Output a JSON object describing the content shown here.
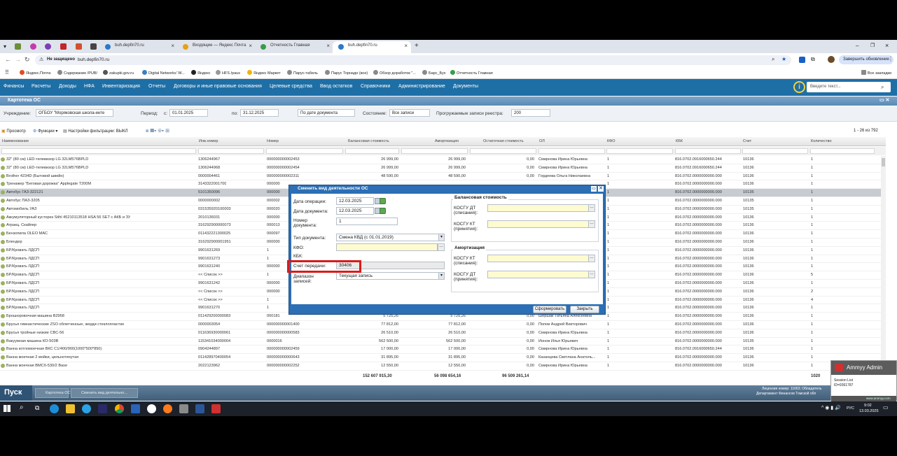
{
  "browser": {
    "tabs": [
      {
        "label": "buh.depfin70.ru"
      },
      {
        "label": "Входящие — Яндекс Почта"
      },
      {
        "label": "Отчетность Главная"
      },
      {
        "label": "buh.depfin70.ru"
      }
    ],
    "new_tab": "+",
    "security_label": "Не защищено",
    "url": "buh.depfin70.ru",
    "update_button": "Завершить обновление",
    "bookmarks": [
      "Яндекс.Почта",
      "Содержание /PUB/",
      "zakupki.gov.ru",
      "Digital Networks' W...",
      "Яндекс",
      "HFS /paus",
      "Яндекс Маркет",
      "Парус-табель",
      "Парус Торнадо (все)",
      "Обзор доработок \"...",
      "Барс_Бух",
      "Отчетность Главная"
    ],
    "all_bookmarks": "Все закладки"
  },
  "app_menu": [
    "Финансы",
    "Расчеты",
    "Доходы",
    "НФА",
    "Инвентаризация",
    "Отчеты",
    "Договоры и иные правовые основания",
    "Целевые средства",
    "Ввод остатков",
    "Справочники",
    "Администрирование",
    "Документы"
  ],
  "search_placeholder": "Введите текст...",
  "window_title": "Картотека ОС",
  "filters": {
    "institution_label": "Учреждение:",
    "institution_value": "ОГБОУ \"Моряковская школа-инте",
    "period_label": "Период:",
    "from_label": "с:",
    "from_value": "01.01.2025",
    "to_label": "по:",
    "to_value": "31.12.2025",
    "date_mode": "По дате документа",
    "state_label": "Состояние:",
    "state_value": "Все записи",
    "registry_label": "Прогружаемые записи реестра:",
    "registry_value": "200"
  },
  "toolbar": {
    "view": "Просмотр",
    "functions": "Функции",
    "filter_settings": "Настройки фильтрации: ВЫКЛ",
    "pager": "1 - 26 из 792"
  },
  "columns": [
    "Наименование",
    "Инв.номер",
    "Номер",
    "Балансовая стоимость",
    "Амортизация",
    "Остаточная стоимость",
    "ОЛ",
    "КФО",
    "КБК",
    "Счет",
    "Количество"
  ],
  "rows": [
    [
      "32\" (80 см) LED-телевизор LG 32LM576BPLD",
      "1306244967",
      "000000000002453",
      "26 999,00",
      "26 999,00",
      "0,00",
      "Смирнова Ирина Юрьевна",
      "1",
      "816.0702.0916000650.244",
      "10136",
      "1"
    ],
    [
      "32\" (80 см) LED-телевизор LG 32LM576BPLD",
      "1306244968",
      "000000000002454",
      "26 999,00",
      "26 999,00",
      "0,00",
      "Смирнова Ирина Юрьевна",
      "1",
      "816.0702.0916000650.244",
      "10136",
      "1"
    ],
    [
      "Brother 4234D (Бытовой швейн)",
      "0000004461",
      "000000000002311",
      "48 590,00",
      "48 590,00",
      "0,00",
      "Гордеева Ольга Николаевна",
      "1",
      "816.0702.0000000000.000",
      "10136",
      "1"
    ],
    [
      "Тренажер \"Беговая дорожка\" Applegate T200M",
      "3143322001700",
      "000000",
      "",
      "",
      "",
      "",
      "1",
      "816.0702.0000000000.000",
      "10136",
      "1"
    ],
    [
      "Автобус ГАЗ-322121",
      "5101350096",
      "000000",
      "",
      "",
      "",
      "",
      "1",
      "816.0702.0000000000.000",
      "10135",
      "1"
    ],
    [
      "Автобус ПАЗ-3205",
      "0000000002",
      "000002",
      "",
      "",
      "",
      "",
      "1",
      "816.0702.0000000000.000",
      "10135",
      "1"
    ],
    [
      "Автомобиль УАЗ",
      "031535920100003",
      "000020",
      "",
      "",
      "",
      "",
      "1",
      "816.0702.0000000000.000",
      "10135",
      "1"
    ],
    [
      "Аккумуляторный кусторез Stihl 45210113518 HSA 56 SET с АКБ и ЗУ",
      "2010136031",
      "000000",
      "",
      "",
      "",
      "",
      "1",
      "816.0702.0000000000.000",
      "10136",
      "1"
    ],
    [
      "Атракц. Скайпер",
      "316292900000073",
      "000013",
      "",
      "",
      "",
      "",
      "1",
      "816.0702.0000000000.000",
      "10136",
      "1"
    ],
    [
      "Бензопила OLEO MAC",
      "011432221300025",
      "000097",
      "",
      "",
      "",
      "",
      "1",
      "816.0702.0000000000.000",
      "10136",
      "1"
    ],
    [
      "Блендер",
      "316292900001951",
      "000000",
      "",
      "",
      "",
      "",
      "1",
      "816.0702.0000000000.000",
      "10136",
      "1"
    ],
    [
      "БР/Кровать ЛДСП",
      "9901631269",
      "1",
      "",
      "",
      "",
      "",
      "1",
      "816.0702.0000000000.000",
      "10136",
      "1"
    ],
    [
      "БР/Кровать ЛДСП",
      "9901631273",
      "1",
      "",
      "",
      "",
      "",
      "1",
      "816.0702.0000000000.000",
      "10136",
      "1"
    ],
    [
      "БР/Кровать ЛДСП",
      "9901631240",
      "000000",
      "",
      "",
      "",
      "",
      "1",
      "816.0702.0000000000.000",
      "10136",
      "1"
    ],
    [
      "БР/Кровать ЛДСП",
      "<< Список >>",
      "1",
      "",
      "",
      "",
      "",
      "1",
      "816.0702.0000000000.000",
      "10136",
      "5"
    ],
    [
      "БР/Кровать ЛДСП",
      "9901631242",
      "000000",
      "",
      "",
      "",
      "",
      "1",
      "816.0702.0000000000.000",
      "10136",
      "1"
    ],
    [
      "БР/Кровать ЛДСП",
      "<< Список >>",
      "000000",
      "",
      "",
      "",
      "",
      "1",
      "816.0702.0000000000.000",
      "10136",
      "2"
    ],
    [
      "БР/Кровать ЛДСП",
      "<< Список >>",
      "1",
      "",
      "",
      "",
      "",
      "1",
      "816.0702.0000000000.000",
      "10136",
      "4"
    ],
    [
      "БР/Кровать ЛДСП",
      "9901631270",
      "1",
      "",
      "",
      "",
      "",
      "1",
      "816.0702.0000000000.000",
      "10136",
      "1"
    ],
    [
      "Брошюровочная машина B2958",
      "011429200000083",
      "000181",
      "5 725,26",
      "5 725,26",
      "0,00",
      "Шершак Татьяна Алексеевна",
      "1",
      "816.0702.0000000000.000",
      "10136",
      "1"
    ],
    [
      "Брусья гимнастические ZSO облегченные, жерди стеклопластик",
      "0000003054",
      "000000000001400",
      "77 812,00",
      "77 812,00",
      "0,00",
      "Попов Андрей Викторович",
      "1",
      "816.0702.0000000000.000",
      "10136",
      "1"
    ],
    [
      "Брусья тройные низкие CBC-56",
      "011636930000061",
      "000000000000583",
      "26 510,00",
      "26 510,00",
      "0,00",
      "Смирнова Ирина Юрьевна",
      "1",
      "816.0702.0000000000.000",
      "10136",
      "1"
    ],
    [
      "Вакуумная машина КО-503В",
      "115341034000004",
      "0000016",
      "562 500,00",
      "562 500,00",
      "0,00",
      "Ионов Илья Юрьевич",
      "1",
      "816.0702.0000000000.000",
      "10135",
      "1"
    ],
    [
      "Ванна котломоечная ВКС С1/400/900(1000*500*850)",
      "0904244897",
      "000000000002459",
      "17 000,00",
      "17 000,00",
      "0,00",
      "Смирнова Ирина Юрьевна",
      "1",
      "816.0702.0916000650.244",
      "10136",
      "1"
    ],
    [
      "Ванна моечная 2 мойки, цельнотянутая",
      "011428970400054",
      "000000000000643",
      "31 895,00",
      "31 895,00",
      "0,00",
      "Казанцева Светлана Анатоль...",
      "1",
      "816.0702.0000000000.000",
      "10136",
      "1"
    ],
    [
      "Ванна моечная ВМСб-530/2 Base",
      "2022123962",
      "000000000002252",
      "12 550,00",
      "12 550,00",
      "0,00",
      "Смирнова Ирина Юрьевна",
      "1",
      "816.0702.0000000000.000",
      "10136",
      "1"
    ]
  ],
  "totals": {
    "balance": "152 607 915,30",
    "amort": "56 098 654,16",
    "residual": "96 509 261,14",
    "qty": "1020"
  },
  "dialog": {
    "title": "Сменить вид деятельности ОС",
    "op_date_label": "Дата операции:",
    "op_date": "12.03.2025",
    "doc_date_label": "Дата документа:",
    "doc_date": "12.03.2025",
    "doc_num_label": "Номер документа:",
    "doc_num": "1",
    "doc_type_label": "Тип документа:",
    "doc_type": "Смена КВД (с 01.01.2019)",
    "kfo_label": "КФО:",
    "kbk_label": "КБК:",
    "account_label": "Счет передачи:",
    "account": "30406",
    "range_label": "Диапазон записей:",
    "range": "Текущая запись",
    "balance_group": "Балансовая стоимость",
    "kosgu_dt_write": "КОСГУ ДТ (списания):",
    "kosgu_kt_accept": "КОСГУ КТ (принятия):",
    "amort_group": "Амортизация",
    "kosgu_kt_write": "КОСГУ КТ (списания):",
    "kosgu_dt_accept": "КОСГУ ДТ (принятия):",
    "form_button": "Сформировать",
    "close_button": "Закрыть"
  },
  "app_taskbar": {
    "start": "Пуск",
    "items": [
      "Картотека ОС",
      "Сменить вид деятельно..."
    ],
    "license": "Лицензия номер: 11663; Обладатель",
    "org": "Департамент Финансов Томской обл"
  },
  "ammyy": {
    "title": "Ammyy Admin",
    "session": "Session List",
    "id": "ID=9361787",
    "site": "www.ammyy.com"
  },
  "windows": {
    "time": "9:02",
    "date": "13.03.2025",
    "lang": "РУС"
  }
}
